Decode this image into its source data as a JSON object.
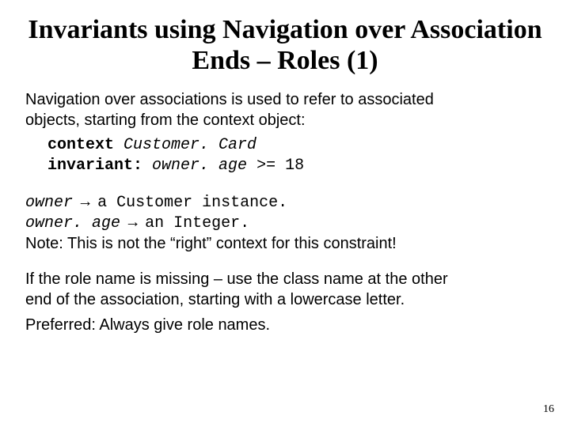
{
  "title": "Invariants using Navigation over Association Ends – Roles (1)",
  "intro_l1": "Navigation over associations is used to refer to associated",
  "intro_l2": "objects, starting from the context object:",
  "code": {
    "kw_context": "context",
    "context_expr": " Customer. Card",
    "kw_invariant": "invariant:",
    "inv_expr": " owner. age ",
    "inv_op": ">= 18"
  },
  "explain": {
    "owner_term": "owner",
    "arrow": " → ",
    "owner_desc": "a Customer instance.",
    "ownerage_term": "owner. age",
    "ownerage_desc": "an Integer.",
    "note": "Note: This is not the “right” context for this constraint!"
  },
  "missing_l1": "If the role name is missing – use the class name at the other",
  "missing_l2": "end of the association, starting with a lowercase letter.",
  "preferred": "Preferred: Always give role names.",
  "page_number": "16"
}
